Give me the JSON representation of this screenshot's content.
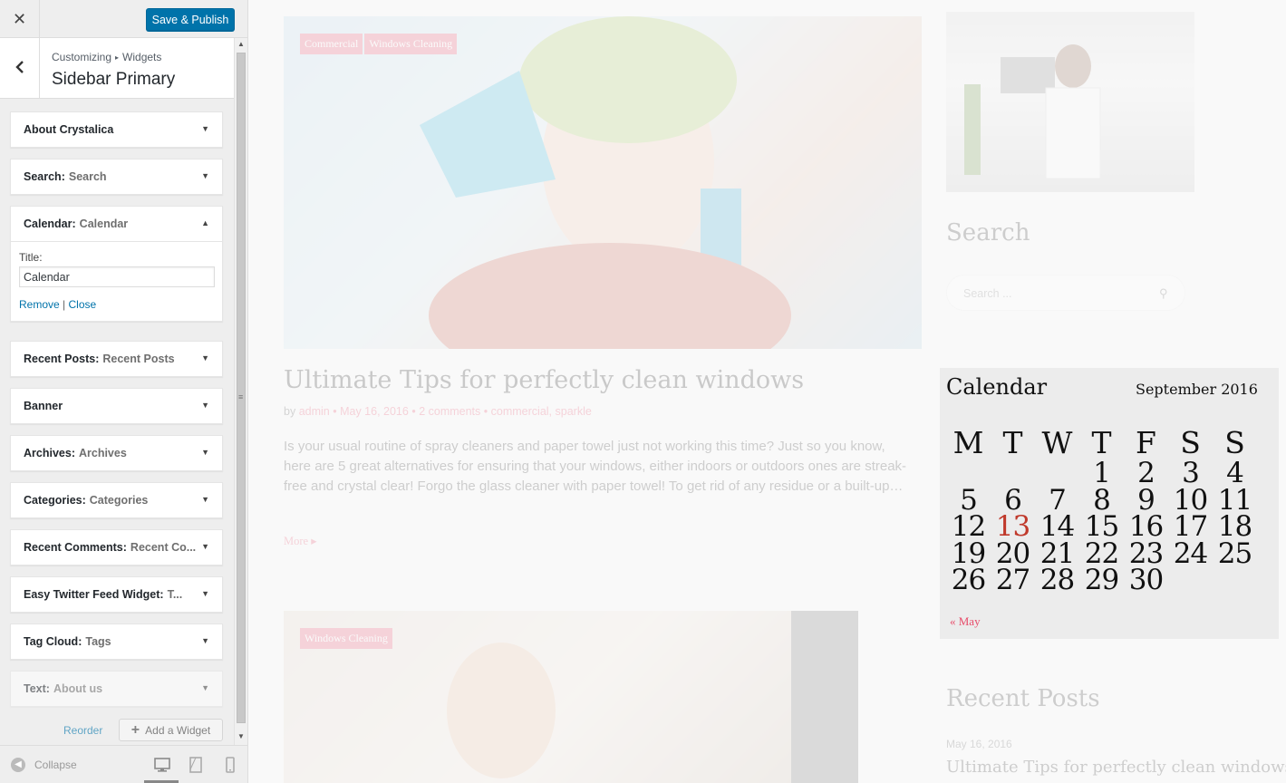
{
  "customizer": {
    "close_icon": "close-icon",
    "publish_label": "Save & Publish",
    "breadcrumb_root": "Customizing",
    "breadcrumb_child": "Widgets",
    "section_title": "Sidebar Primary",
    "widgets": [
      {
        "name": "About Crystalica",
        "instance": ""
      },
      {
        "name": "Search",
        "instance": "Search"
      },
      {
        "name": "Calendar",
        "instance": "Calendar"
      },
      {
        "name": "Recent Posts",
        "instance": "Recent Posts"
      },
      {
        "name": "Banner",
        "instance": ""
      },
      {
        "name": "Archives",
        "instance": "Archives"
      },
      {
        "name": "Categories",
        "instance": "Categories"
      },
      {
        "name": "Recent Comments",
        "instance": "Recent Co..."
      },
      {
        "name": "Easy Twitter Feed Widget",
        "instance": "T..."
      },
      {
        "name": "Tag Cloud",
        "instance": "Tags"
      },
      {
        "name": "Text",
        "instance": "About us"
      }
    ],
    "expanded_widget": {
      "title_label": "Title:",
      "title_value": "Calendar",
      "remove_label": "Remove",
      "separator": "|",
      "close_label": "Close"
    },
    "reorder_label": "Reorder",
    "add_widget_label": "Add a Widget",
    "collapse_label": "Collapse"
  },
  "preview": {
    "post1": {
      "tags": [
        "Commercial",
        "Windows Cleaning"
      ],
      "title": "Ultimate Tips for perfectly clean windows",
      "meta_by": "by",
      "meta_author": "admin",
      "meta_date": "May 16, 2016",
      "meta_comments": "2 comments",
      "meta_categories": "commercial, sparkle",
      "excerpt": "Is your usual routine of spray cleaners and paper towel just not working this time? Just so you know, here are 5 great alternatives for ensuring that your windows, either indoors or outdoors ones are streak-free and crystal clear! Forgo the glass cleaner with paper towel! To get rid of any residue or a built-up…",
      "more_label": "More"
    },
    "post2": {
      "tags": [
        "Windows Cleaning"
      ]
    },
    "sidebar": {
      "search_title": "Search",
      "search_placeholder": "Search ...",
      "calendar_title": "Calendar",
      "calendar_caption": "September 2016",
      "weekdays": [
        "M",
        "T",
        "W",
        "T",
        "F",
        "S",
        "S"
      ],
      "weeks": [
        [
          "",
          "",
          "",
          "1",
          "2",
          "3",
          "4"
        ],
        [
          "5",
          "6",
          "7",
          "8",
          "9",
          "10",
          "11"
        ],
        [
          "12",
          "13",
          "14",
          "15",
          "16",
          "17",
          "18"
        ],
        [
          "19",
          "20",
          "21",
          "22",
          "23",
          "24",
          "25"
        ],
        [
          "26",
          "27",
          "28",
          "29",
          "30",
          "",
          ""
        ]
      ],
      "today": "13",
      "prev_month": "« May",
      "recent_title": "Recent Posts",
      "recent_date": "May 16, 2016",
      "recent_post": "Ultimate Tips for perfectly clean windows"
    }
  },
  "colors": {
    "accent": "#0073aa",
    "brand_pink": "#e84c6a",
    "today": "#c0392b"
  }
}
